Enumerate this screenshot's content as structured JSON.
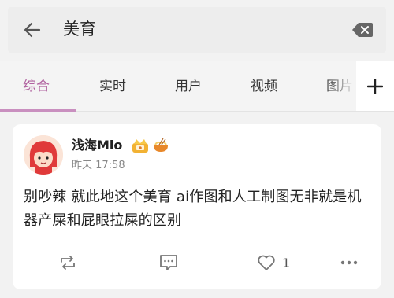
{
  "search": {
    "query": "美育"
  },
  "tabs": [
    {
      "label": "综合",
      "active": true
    },
    {
      "label": "实时",
      "active": false
    },
    {
      "label": "用户",
      "active": false
    },
    {
      "label": "视频",
      "active": false
    },
    {
      "label": "图片",
      "active": false
    }
  ],
  "post": {
    "username": "浅海Mio",
    "timestamp": "昨天 17:58",
    "text": "别吵辣 就此地这个美育 ai作图和人工制图无非就是机器产屎和屁眼拉屎的区别",
    "like_count": "1"
  },
  "colors": {
    "accent": "#b0629f",
    "indicator": "#c98fbf",
    "background": "#f2f2f2"
  },
  "icons": {
    "back": "arrow-left-icon",
    "clear": "backspace-icon",
    "add": "plus-icon",
    "repost": "repost-icon",
    "comment": "comment-icon",
    "like": "heart-icon",
    "more": "more-icon",
    "badges": [
      "crown-badge-icon",
      "noodle-bowl-icon"
    ]
  }
}
